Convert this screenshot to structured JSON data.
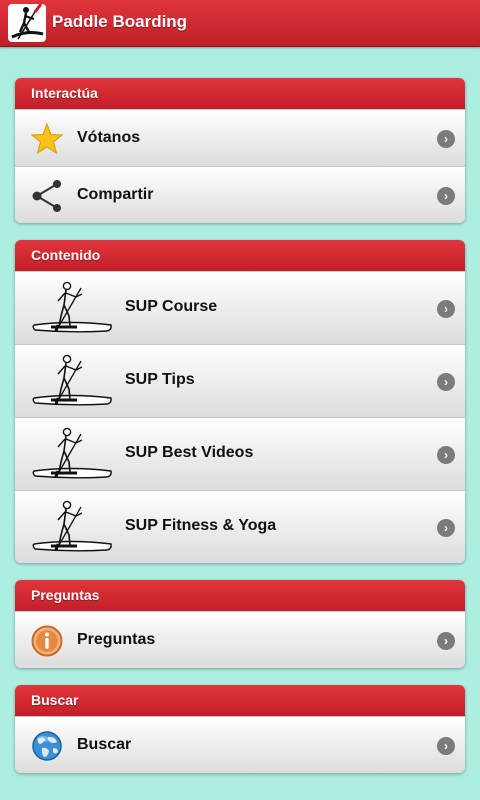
{
  "app": {
    "title": "Paddle Boarding",
    "icon": "paddleboarder-icon"
  },
  "colors": {
    "background": "#aeeee1",
    "header_red": "#d22a32",
    "row_text": "#111111",
    "chevron": "#7b7b7b"
  },
  "groups": [
    {
      "title": "Interactúa",
      "items": [
        {
          "label": "Vótanos",
          "icon": "star-icon"
        },
        {
          "label": "Compartir",
          "icon": "share-icon"
        }
      ]
    },
    {
      "title": "Contenido",
      "items": [
        {
          "label": "SUP Course",
          "icon": "paddleboarder-icon"
        },
        {
          "label": "SUP Tips",
          "icon": "paddleboarder-icon"
        },
        {
          "label": "SUP Best Videos",
          "icon": "paddleboarder-icon"
        },
        {
          "label": "SUP Fitness & Yoga",
          "icon": "paddleboarder-icon"
        }
      ]
    },
    {
      "title": "Preguntas",
      "items": [
        {
          "label": "Preguntas",
          "icon": "info-icon"
        }
      ]
    },
    {
      "title": "Buscar",
      "items": [
        {
          "label": "Buscar",
          "icon": "globe-icon"
        }
      ]
    }
  ]
}
